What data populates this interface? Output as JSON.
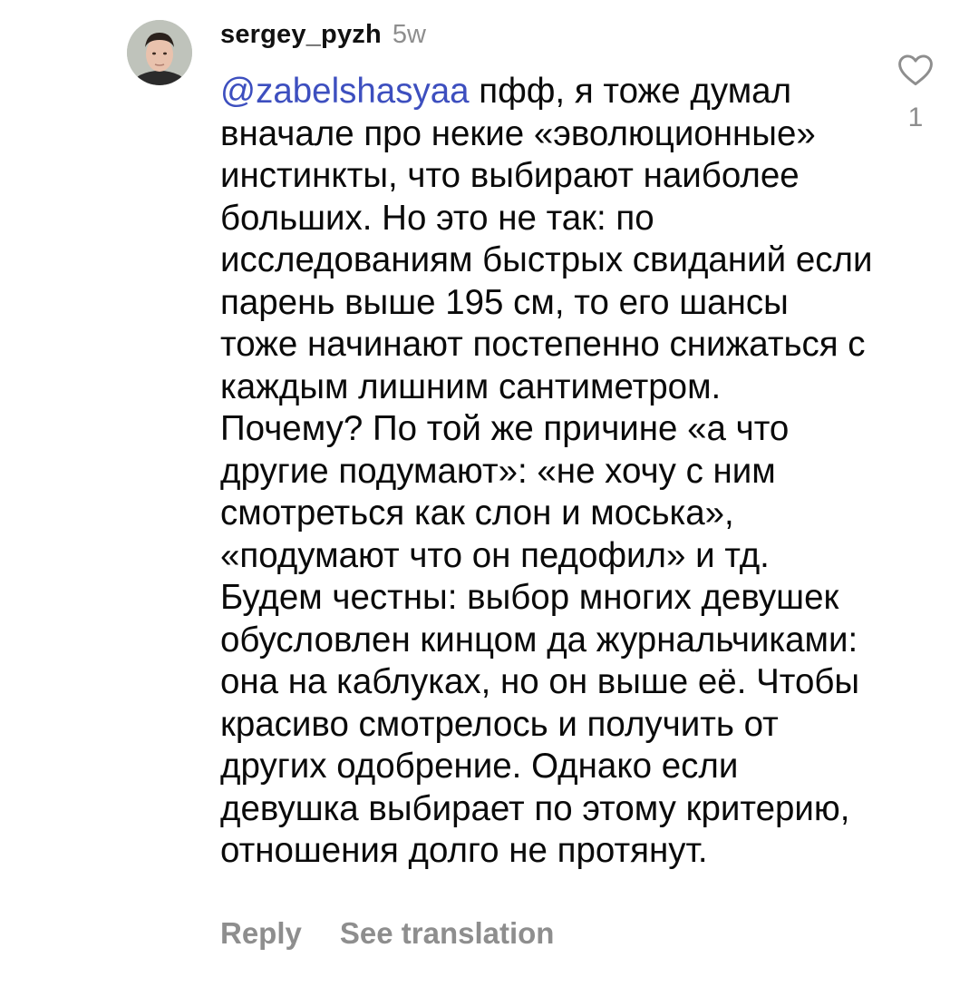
{
  "comment": {
    "username": "sergey_pyzh",
    "timestamp": "5w",
    "mention": "@zabelshasyaa",
    "text": " пфф, я тоже думал вначале про некие «эволюционные» инстинкты, что выбирают наиболее больших. Но это не так: по исследованиям быстрых свиданий если парень выше 195 см, то его шансы тоже начинают постепенно снижаться с каждым лишним сантиметром. Почему? По той же причине «а что другие подумают»: «не хочу с ним смотреться как слон и моська», «подумают что он педофил» и тд. Будем честны: выбор многих девушек обусловлен кинцом да журнальчиками: она на каблуках, но он выше её. Чтобы красиво смотрелось и получить от других одобрение. Однако если девушка выбирает по этому критерию, отношения долго не протянут.",
    "like_count": "1",
    "like_icon": "heart-outline-icon"
  },
  "actions": {
    "reply_label": "Reply",
    "translate_label": "See translation"
  },
  "colors": {
    "mention": "#3d4fbf",
    "secondary_text": "#8e8e8e",
    "primary_text": "#0a0a0a"
  }
}
